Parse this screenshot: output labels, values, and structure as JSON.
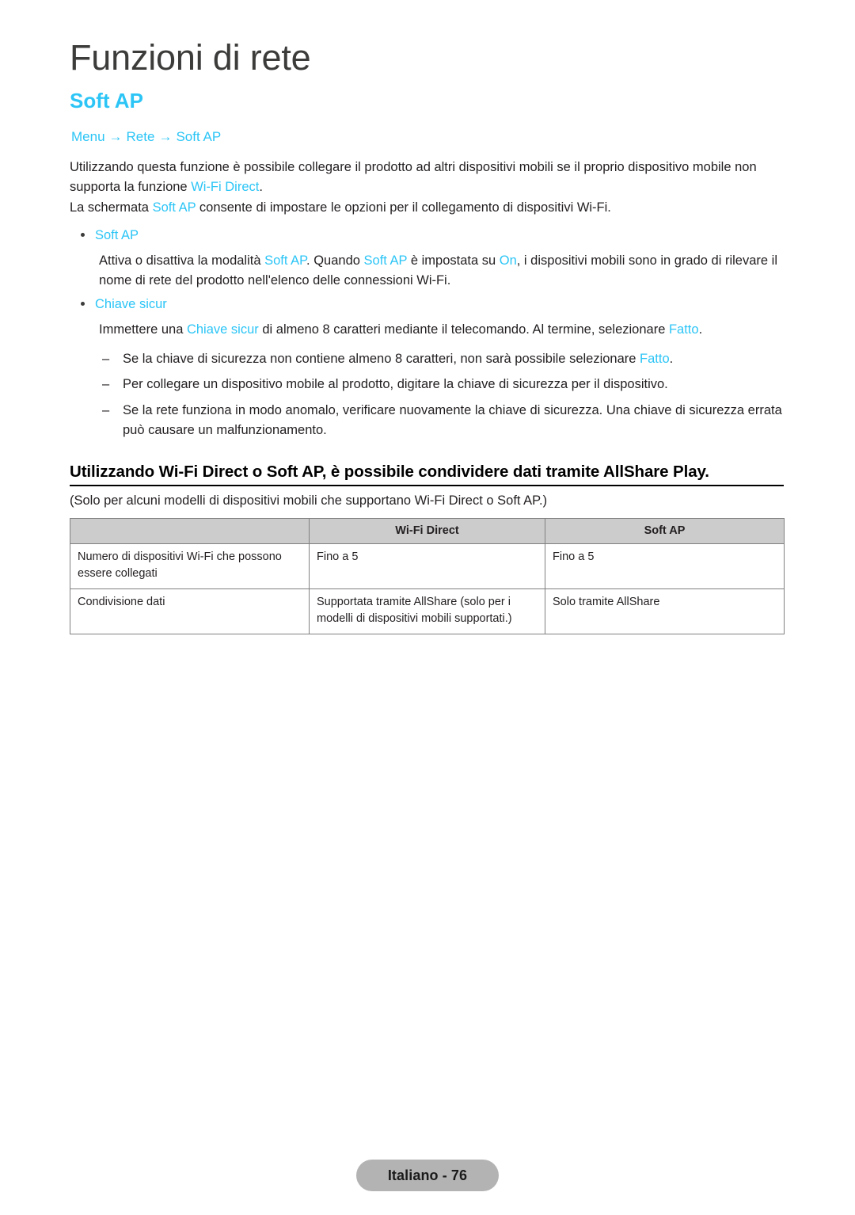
{
  "page": {
    "chapter_title": "Funzioni di rete",
    "section_title": "Soft AP",
    "accent_color": "#2cc5f6",
    "text_color": "#231f20",
    "table_header_bg": "#cccccc",
    "footer_pill_bg": "#b3b3b3"
  },
  "breadcrumb": {
    "item1": "Menu",
    "arrow1": "→",
    "item2": "Rete",
    "arrow2": "→",
    "item3": "Soft AP"
  },
  "intro": {
    "p1_a": "Utilizzando questa funzione è possibile collegare il prodotto ad altri dispositivi mobili se il proprio dispositivo mobile non supporta la funzione ",
    "p1_hl": "Wi-Fi Direct",
    "p1_b": ".",
    "p2_a": "La schermata ",
    "p2_hl": "Soft AP",
    "p2_b": " consente di impostare le opzioni per il collegamento di dispositivi Wi-Fi."
  },
  "bullets": [
    {
      "label": "Soft AP",
      "body_a": "Attiva o disattiva la modalità ",
      "body_hl1": "Soft AP",
      "body_b": ". Quando ",
      "body_hl2": "Soft AP",
      "body_c": " è impostata su ",
      "body_hl3": "On",
      "body_d": ", i dispositivi mobili sono in grado di rilevare il nome di rete del prodotto nell'elenco delle connessioni Wi-Fi."
    },
    {
      "label": "Chiave sicur",
      "body_a": "Immettere una ",
      "body_hl1": "Chiave sicur",
      "body_b": " di almeno 8 caratteri mediante il telecomando. Al termine, selezionare ",
      "body_hl2": "Fatto",
      "body_c": "."
    }
  ],
  "dashes": [
    {
      "mark": "–",
      "text_a": "Se la chiave di sicurezza non contiene almeno 8 caratteri, non sarà possibile selezionare ",
      "text_hl": "Fatto",
      "text_b": "."
    },
    {
      "mark": "–",
      "text_a": "Per collegare un dispositivo mobile al prodotto, digitare la chiave di sicurezza per il dispositivo.",
      "text_hl": "",
      "text_b": ""
    },
    {
      "mark": "–",
      "text_a": "Se la rete funziona in modo anomalo, verificare nuovamente la chiave di sicurezza. Una chiave di sicurezza errata può causare un malfunzionamento.",
      "text_hl": "",
      "text_b": ""
    }
  ],
  "notice": {
    "heading": "Utilizzando Wi-Fi Direct o Soft AP, è possibile condividere dati tramite AllShare Play.",
    "subtext": "(Solo per alcuni modelli di dispositivi mobili che supportano Wi-Fi Direct o Soft AP.)"
  },
  "table": {
    "headers": [
      "",
      "Wi-Fi Direct",
      "Soft AP"
    ],
    "rows": [
      {
        "label": "Numero di dispositivi Wi-Fi che possono essere collegati",
        "wifi_direct": "Fino a 5",
        "soft_ap": "Fino a 5"
      },
      {
        "label": "Condivisione dati",
        "wifi_direct": "Supportata tramite AllShare (solo per i modelli di dispositivi mobili supportati.)",
        "soft_ap": "Solo tramite AllShare"
      }
    ]
  },
  "footer": {
    "label": "Italiano - 76"
  }
}
